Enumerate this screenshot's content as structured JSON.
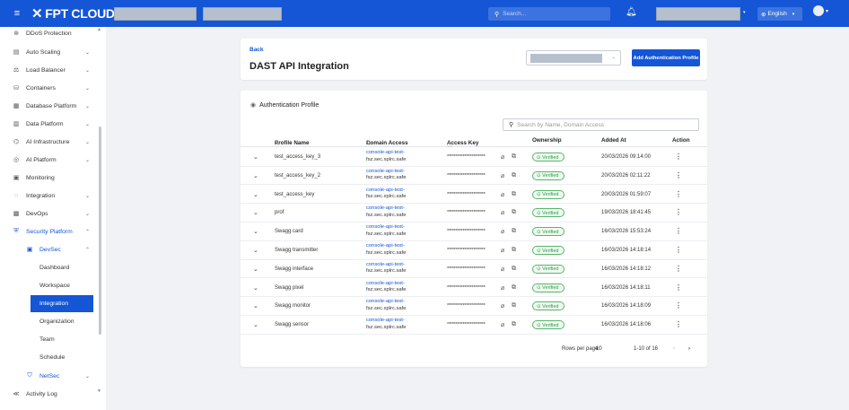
{
  "header": {
    "brand": "FPT CLOUD",
    "search_placeholder": "Search...",
    "language": "English"
  },
  "sidebar": {
    "items": [
      {
        "label": "DDoS Protection",
        "icon": "shield-icon",
        "chevron": ""
      },
      {
        "label": "Auto Scaling",
        "icon": "scaling-icon",
        "chevron": "⌄"
      },
      {
        "label": "Load Balancer",
        "icon": "load-balancer-icon",
        "chevron": "⌄"
      },
      {
        "label": "Containers",
        "icon": "containers-icon",
        "chevron": "⌄"
      },
      {
        "label": "Database Platform",
        "icon": "database-icon",
        "chevron": "⌄"
      },
      {
        "label": "Data Platform",
        "icon": "data-platform-icon",
        "chevron": "⌄"
      },
      {
        "label": "AI Infrastructure",
        "icon": "ai-infrastructure-icon",
        "chevron": "⌄"
      },
      {
        "label": "AI Platform",
        "icon": "ai-platform-icon",
        "chevron": "⌄"
      },
      {
        "label": "Monitoring",
        "icon": "monitoring-icon",
        "chevron": ""
      },
      {
        "label": "Integration",
        "icon": "integration-icon",
        "chevron": "⌄"
      },
      {
        "label": "DevOps",
        "icon": "devops-icon",
        "chevron": "⌄"
      },
      {
        "label": "Security Platform",
        "icon": "security-icon",
        "chevron": "⌃"
      }
    ],
    "devsec": {
      "label": "DevSec",
      "chevron": "⌃"
    },
    "subitems": [
      "Dashboard",
      "Workspace",
      "Integration",
      "Organization",
      "Team",
      "Schedule"
    ],
    "active_sub": "Integration",
    "netsec": {
      "label": "NetSec",
      "chevron": "⌄"
    },
    "activity_log": "Activity Log"
  },
  "page": {
    "back_label": "Back",
    "title": "DAST API Integration",
    "add_button": "Add Authentication Profile"
  },
  "table": {
    "card_title": "Authentication Profile",
    "search_placeholder": "Search by Name, Domain Access",
    "columns": {
      "profile_name": "Profile Name",
      "domain_access": "Domain Access",
      "access_key": "Access Key",
      "ownership": "Ownership",
      "added_at": "Added At",
      "action": "Action"
    },
    "rows": [
      {
        "name": "test_access_key_3",
        "domain1": "console-api-test-",
        "domain2": "fsz.sec.xplrc.safe",
        "key": "**********************",
        "ownership": "Verified",
        "added": "20/03/2026 09:14:00"
      },
      {
        "name": "test_access_key_2",
        "domain1": "console-api-test-",
        "domain2": "fsz.sec.xplrc.safe",
        "key": "**********************",
        "ownership": "Verified",
        "added": "20/03/2026 02:11:22"
      },
      {
        "name": "test_access_key",
        "domain1": "console-api-test-",
        "domain2": "fsz.sec.xplrc.safe",
        "key": "**********************",
        "ownership": "Verified",
        "added": "20/03/2026 01:59:07"
      },
      {
        "name": "prof",
        "domain1": "console-api-test-",
        "domain2": "fsz.sec.xplrc.safe",
        "key": "**********************",
        "ownership": "Verified",
        "added": "19/03/2026 18:41:45"
      },
      {
        "name": "Swagg card",
        "domain1": "console-api-test-",
        "domain2": "fsz.sec.xplrc.safe",
        "key": "**********************",
        "ownership": "Verified",
        "added": "16/03/2026 15:53:24"
      },
      {
        "name": "Swagg transmitter",
        "domain1": "console-api-test-",
        "domain2": "fsz.sec.xplrc.safe",
        "key": "**********************",
        "ownership": "Verified",
        "added": "16/03/2026 14:18:14"
      },
      {
        "name": "Swagg interface",
        "domain1": "console-api-test-",
        "domain2": "fsz.sec.xplrc.safe",
        "key": "**********************",
        "ownership": "Verified",
        "added": "16/03/2026 14:18:12"
      },
      {
        "name": "Swagg pixel",
        "domain1": "console-api-test-",
        "domain2": "fsz.sec.xplrc.safe",
        "key": "**********************",
        "ownership": "Verified",
        "added": "16/03/2026 14:18:11"
      },
      {
        "name": "Swagg monitor",
        "domain1": "console-api-test-",
        "domain2": "fsz.sec.xplrc.safe",
        "key": "**********************",
        "ownership": "Verified",
        "added": "16/03/2026 14:18:09"
      },
      {
        "name": "Swagg sensor",
        "domain1": "console-api-test-",
        "domain2": "fsz.sec.xplrc.safe",
        "key": "**********************",
        "ownership": "Verified",
        "added": "16/03/2026 14:18:06"
      }
    ],
    "pagination": {
      "rows_per_page_label": "Rows per page:",
      "rows_per_page": "10",
      "range": "1-10 of 16"
    }
  },
  "colors": {
    "primary": "#1456d6",
    "verified": "#2d9b46"
  }
}
